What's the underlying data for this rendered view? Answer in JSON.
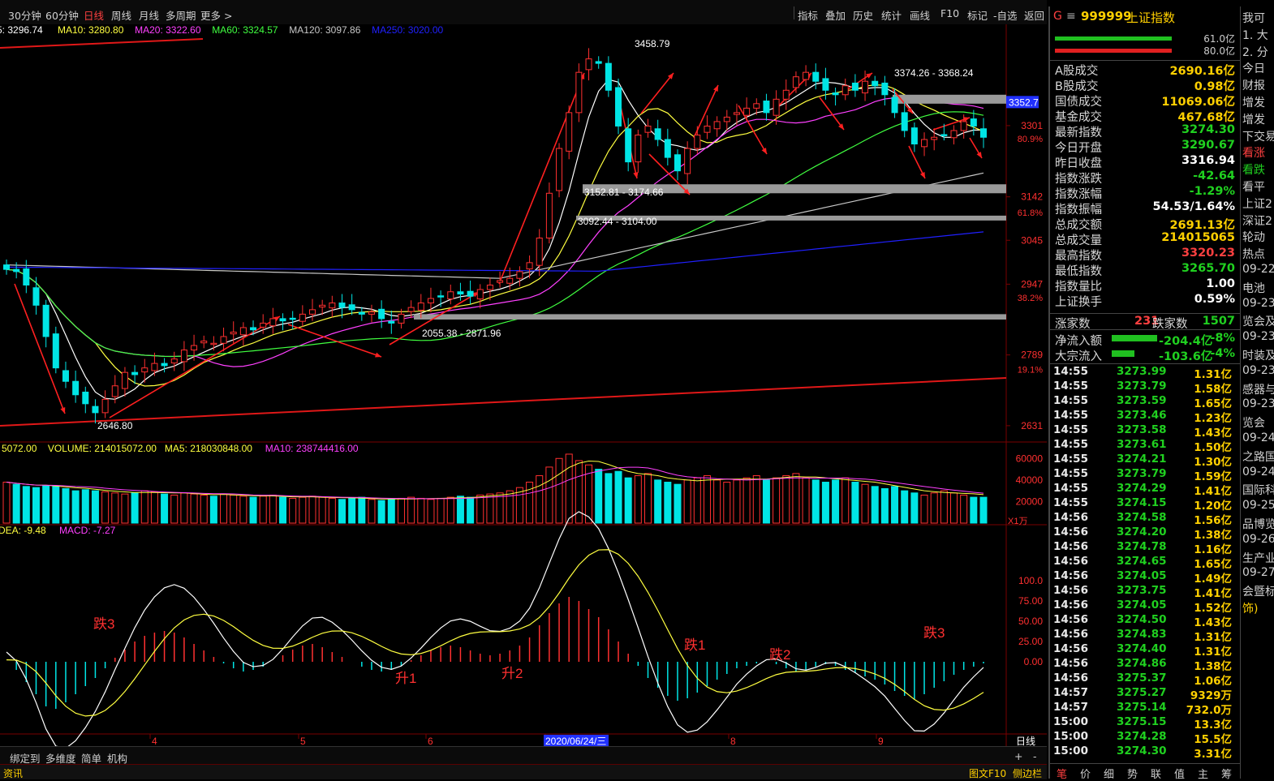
{
  "topbar": {
    "tabs": [
      "30分钟",
      "60分钟",
      "日线",
      "周线",
      "月线",
      "多周期",
      "更多 >"
    ],
    "active_tab": "日线",
    "tools": [
      "指标",
      "叠加",
      "历史",
      "统计",
      "画线",
      "F10",
      "标记",
      "-自选",
      "返回"
    ]
  },
  "legend": {
    "ma": [
      {
        "label": "5: 3296.74",
        "color": "#ffffff"
      },
      {
        "label": "MA10: 3280.80",
        "color": "#ffff40"
      },
      {
        "label": "MA20: 3322.60",
        "color": "#ff40ff"
      },
      {
        "label": "MA60: 3324.57",
        "color": "#40ff40"
      },
      {
        "label": "MA120: 3097.86",
        "color": "#c8c8c8"
      },
      {
        "label": "MA250: 3020.00",
        "color": "#2020ff"
      }
    ],
    "volume": [
      {
        "label": "5072.00",
        "color": "#ffff40"
      },
      {
        "label": "VOLUME: 214015072.00",
        "color": "#ffff40"
      },
      {
        "label": "MA5: 218030848.00",
        "color": "#ffff40"
      },
      {
        "label": "MA10: 238744416.00",
        "color": "#ff40ff"
      }
    ],
    "macd": [
      {
        "label": "DEA: -9.48",
        "color": "#ffff40"
      },
      {
        "label": "MACD: -7.27",
        "color": "#ff40ff"
      }
    ]
  },
  "chart_data": {
    "type": "candlestick",
    "title": "999999 上证指数 日线",
    "price_axis": {
      "ticks": [
        "3301",
        "3142",
        "3045",
        "2947",
        "2789",
        "2631"
      ],
      "fib": [
        "80.9%",
        "61.8%",
        "38.2%",
        "19.1%"
      ],
      "current": "3352.7"
    },
    "volume_axis": {
      "ticks": [
        "60000",
        "40000",
        "20000"
      ],
      "unit": "X1万"
    },
    "macd_axis": {
      "ticks": [
        "100.0",
        "75.00",
        "50.00",
        "25.00",
        "0.00"
      ]
    },
    "x_ticks": [
      "4",
      "5",
      "6",
      "2020/06/24/三",
      "8",
      "9"
    ],
    "bottom_label": "日线",
    "annotations": {
      "high": "3458.79",
      "low": "2646.80",
      "range_top": "3374.26 - 3368.24",
      "range_mid1": "3152.81 - 3174.66",
      "range_mid2": "3092.44 - 3104.00",
      "range_low": "2055.38 - 2871.96"
    },
    "macd_labels": [
      "跌3",
      "升1",
      "升2",
      "跌1",
      "跌2",
      "跌3"
    ],
    "closes": [
      2980,
      2975,
      2945,
      2900,
      2830,
      2760,
      2730,
      2700,
      2680,
      2660,
      2690,
      2720,
      2750,
      2745,
      2760,
      2770,
      2765,
      2780,
      2800,
      2810,
      2820,
      2815,
      2830,
      2840,
      2850,
      2845,
      2860,
      2870,
      2865,
      2870,
      2880,
      2890,
      2900,
      2905,
      2895,
      2890,
      2880,
      2885,
      2870,
      2860,
      2880,
      2895,
      2905,
      2915,
      2920,
      2930,
      2925,
      2920,
      2935,
      2945,
      2955,
      2960,
      2975,
      2995,
      3050,
      3150,
      3250,
      3330,
      3420,
      3450,
      3440,
      3380,
      3300,
      3220,
      3280,
      3300,
      3270,
      3230,
      3200,
      3250,
      3280,
      3300,
      3310,
      3320,
      3330,
      3340,
      3350,
      3330,
      3360,
      3380,
      3410,
      3420,
      3400,
      3380,
      3370,
      3390,
      3380,
      3400,
      3390,
      3370,
      3330,
      3290,
      3260,
      3270,
      3275,
      3280,
      3290,
      3310,
      3300,
      3275
    ],
    "volumes": [
      38000,
      36000,
      34000,
      33000,
      35000,
      34000,
      32000,
      30000,
      31000,
      30000,
      29000,
      28000,
      27000,
      28000,
      30000,
      29000,
      27000,
      26000,
      28000,
      27000,
      26000,
      25000,
      27000,
      26000,
      25000,
      24000,
      25000,
      26000,
      24000,
      23000,
      24000,
      25000,
      24000,
      23000,
      22000,
      23000,
      24000,
      22000,
      21000,
      22000,
      23000,
      24000,
      23000,
      22000,
      23000,
      24000,
      25000,
      24000,
      26000,
      27000,
      28000,
      30000,
      33000,
      38000,
      44000,
      52000,
      60000,
      64000,
      58000,
      54000,
      50000,
      46000,
      48000,
      42000,
      44000,
      46000,
      40000,
      38000,
      36000,
      40000,
      42000,
      44000,
      40000,
      38000,
      40000,
      42000,
      44000,
      40000,
      42000,
      44000,
      46000,
      42000,
      40000,
      38000,
      40000,
      42000,
      38000,
      36000,
      34000,
      32000,
      34000,
      30000,
      28000,
      26000,
      28000,
      30000,
      28000,
      26000,
      24000,
      24000
    ],
    "macd_bar": [
      0,
      -10,
      -25,
      -40,
      -55,
      -58,
      -50,
      -40,
      -30,
      -20,
      -8,
      5,
      15,
      25,
      32,
      36,
      38,
      36,
      30,
      22,
      14,
      6,
      -2,
      -8,
      -12,
      -10,
      -6,
      0,
      8,
      15,
      20,
      22,
      18,
      12,
      6,
      0,
      -6,
      -10,
      -12,
      -10,
      -5,
      2,
      8,
      14,
      18,
      20,
      18,
      14,
      10,
      8,
      10,
      14,
      20,
      30,
      45,
      60,
      72,
      80,
      75,
      65,
      55,
      40,
      25,
      10,
      -5,
      -20,
      -32,
      -42,
      -48,
      -45,
      -38,
      -30,
      -22,
      -15,
      -8,
      -5,
      -2,
      0,
      -3,
      -8,
      -12,
      -10,
      -6,
      -3,
      -5,
      -10,
      -14,
      -18,
      -22,
      -28,
      -36,
      -42,
      -46,
      -40,
      -32,
      -24,
      -16,
      -10,
      -6,
      -2
    ]
  },
  "sidebar": {
    "code": "999999",
    "name": "上证指数",
    "header_vals": [
      "61.0亿",
      "80.0亿"
    ],
    "rows": [
      {
        "label": "A股成交",
        "value": "2690.16亿",
        "color": "#ffd000"
      },
      {
        "label": "B股成交",
        "value": "0.98亿",
        "color": "#ffd000"
      },
      {
        "label": "国债成交",
        "value": "11069.06亿",
        "color": "#ffd000"
      },
      {
        "label": "基金成交",
        "value": "467.68亿",
        "color": "#ffd000"
      },
      {
        "label": "最新指数",
        "value": "3274.30",
        "color": "#20d020"
      },
      {
        "label": "今日开盘",
        "value": "3290.67",
        "color": "#20d020"
      },
      {
        "label": "昨日收盘",
        "value": "3316.94",
        "color": "#ffffff"
      },
      {
        "label": "指数涨跌",
        "value": "-42.64",
        "color": "#20d020"
      },
      {
        "label": "指数涨幅",
        "value": "-1.29%",
        "color": "#20d020"
      },
      {
        "label": "指数振幅",
        "value": "54.53/1.64%",
        "color": "#ffffff"
      },
      {
        "label": "总成交额",
        "value": "2691.13亿",
        "color": "#ffd000"
      },
      {
        "label": "总成交量",
        "value": "214015065",
        "color": "#ffd000"
      },
      {
        "label": "最高指数",
        "value": "3320.23",
        "color": "#ff4040"
      },
      {
        "label": "最低指数",
        "value": "3265.70",
        "color": "#20d020"
      },
      {
        "label": "指数量比",
        "value": "1.00",
        "color": "#ffffff"
      },
      {
        "label": "上证换手",
        "value": "0.59%",
        "color": "#ffffff"
      }
    ],
    "updown": {
      "up_label": "涨家数",
      "up": "231",
      "down_label": "跌家数",
      "down": "1507"
    },
    "flow": [
      {
        "label": "净流入额",
        "value": "-204.4亿",
        "pct": "-8%"
      },
      {
        "label": "大宗流入",
        "value": "-103.6亿",
        "pct": "-4%"
      }
    ],
    "ticks": [
      {
        "t": "14:55",
        "p": "3273.99",
        "v": "1.31亿"
      },
      {
        "t": "14:55",
        "p": "3273.79",
        "v": "1.58亿"
      },
      {
        "t": "14:55",
        "p": "3273.59",
        "v": "1.65亿"
      },
      {
        "t": "14:55",
        "p": "3273.46",
        "v": "1.23亿"
      },
      {
        "t": "14:55",
        "p": "3273.58",
        "v": "1.43亿"
      },
      {
        "t": "14:55",
        "p": "3273.61",
        "v": "1.50亿"
      },
      {
        "t": "14:55",
        "p": "3274.21",
        "v": "1.30亿"
      },
      {
        "t": "14:55",
        "p": "3273.79",
        "v": "1.59亿"
      },
      {
        "t": "14:55",
        "p": "3274.29",
        "v": "1.41亿"
      },
      {
        "t": "14:55",
        "p": "3274.15",
        "v": "1.20亿"
      },
      {
        "t": "14:56",
        "p": "3274.58",
        "v": "1.56亿"
      },
      {
        "t": "14:56",
        "p": "3274.20",
        "v": "1.38亿"
      },
      {
        "t": "14:56",
        "p": "3274.78",
        "v": "1.16亿"
      },
      {
        "t": "14:56",
        "p": "3274.65",
        "v": "1.65亿"
      },
      {
        "t": "14:56",
        "p": "3274.05",
        "v": "1.49亿"
      },
      {
        "t": "14:56",
        "p": "3273.75",
        "v": "1.41亿"
      },
      {
        "t": "14:56",
        "p": "3274.05",
        "v": "1.52亿"
      },
      {
        "t": "14:56",
        "p": "3274.50",
        "v": "1.43亿"
      },
      {
        "t": "14:56",
        "p": "3274.83",
        "v": "1.31亿"
      },
      {
        "t": "14:56",
        "p": "3274.40",
        "v": "1.31亿"
      },
      {
        "t": "14:56",
        "p": "3274.86",
        "v": "1.38亿"
      },
      {
        "t": "14:56",
        "p": "3275.37",
        "v": "1.06亿"
      },
      {
        "t": "14:57",
        "p": "3275.27",
        "v": "9329万"
      },
      {
        "t": "14:57",
        "p": "3275.14",
        "v": "732.0万"
      },
      {
        "t": "15:00",
        "p": "3275.15",
        "v": "13.3亿"
      },
      {
        "t": "15:00",
        "p": "3274.28",
        "v": "15.5亿"
      },
      {
        "t": "15:00",
        "p": "3274.30",
        "v": "3.31亿"
      }
    ],
    "bottom_tabs": [
      "笔",
      "价",
      "细",
      "势",
      "联",
      "值",
      "主",
      "筹"
    ]
  },
  "bottombar": {
    "items": [
      "绑定到",
      "多维度",
      "简单",
      "机构"
    ],
    "plus": "+",
    "minus": "-"
  },
  "statusbar": {
    "left": "资讯",
    "right1": "图文F10",
    "right2": "侧边栏"
  },
  "news": {
    "lines": [
      {
        "text": "我可",
        "color": "#d0d0d0"
      },
      {
        "text": "1. 大",
        "color": "#d0d0d0"
      },
      {
        "text": "2. 分",
        "color": "#d0d0d0"
      },
      {
        "text": "今日",
        "color": "#d0d0d0"
      },
      {
        "text": "财报",
        "color": "#d0d0d0"
      },
      {
        "text": "增发",
        "color": "#d0d0d0"
      },
      {
        "text": "增发",
        "color": "#d0d0d0"
      },
      {
        "text": "下交易",
        "color": "#d0d0d0"
      },
      {
        "text": "看涨",
        "color": "#ff4040"
      },
      {
        "text": "看跌",
        "color": "#20d020"
      },
      {
        "text": "看平",
        "color": "#d0d0d0"
      },
      {
        "text": "上证2",
        "color": "#d0d0d0"
      },
      {
        "text": "深证2",
        "color": "#d0d0d0"
      },
      {
        "text": "轮动",
        "color": "#d0d0d0"
      },
      {
        "text": "热点",
        "color": "#d0d0d0"
      },
      {
        "text": "09-22",
        "color": "#d0d0d0"
      },
      {
        "text": "电池",
        "color": "#d0d0d0"
      },
      {
        "text": "09-23",
        "color": "#d0d0d0"
      },
      {
        "text": "览会及",
        "color": "#d0d0d0"
      },
      {
        "text": "09-23",
        "color": "#d0d0d0"
      },
      {
        "text": "时装及",
        "color": "#d0d0d0"
      },
      {
        "text": "09-23",
        "color": "#d0d0d0"
      },
      {
        "text": "感器与",
        "color": "#d0d0d0"
      },
      {
        "text": "09-23",
        "color": "#d0d0d0"
      },
      {
        "text": "览会",
        "color": "#d0d0d0"
      },
      {
        "text": "09-24",
        "color": "#d0d0d0"
      },
      {
        "text": "之路国",
        "color": "#d0d0d0"
      },
      {
        "text": "09-24",
        "color": "#d0d0d0"
      },
      {
        "text": "国际科",
        "color": "#d0d0d0"
      },
      {
        "text": "09-25",
        "color": "#d0d0d0"
      },
      {
        "text": "品博览",
        "color": "#d0d0d0"
      },
      {
        "text": "09-26",
        "color": "#d0d0d0"
      },
      {
        "text": "生产业",
        "color": "#d0d0d0"
      },
      {
        "text": "09-27",
        "color": "#d0d0d0"
      },
      {
        "text": "会暨标",
        "color": "#d0d0d0"
      },
      {
        "text": "饰)",
        "color": "#ffd000"
      }
    ]
  }
}
